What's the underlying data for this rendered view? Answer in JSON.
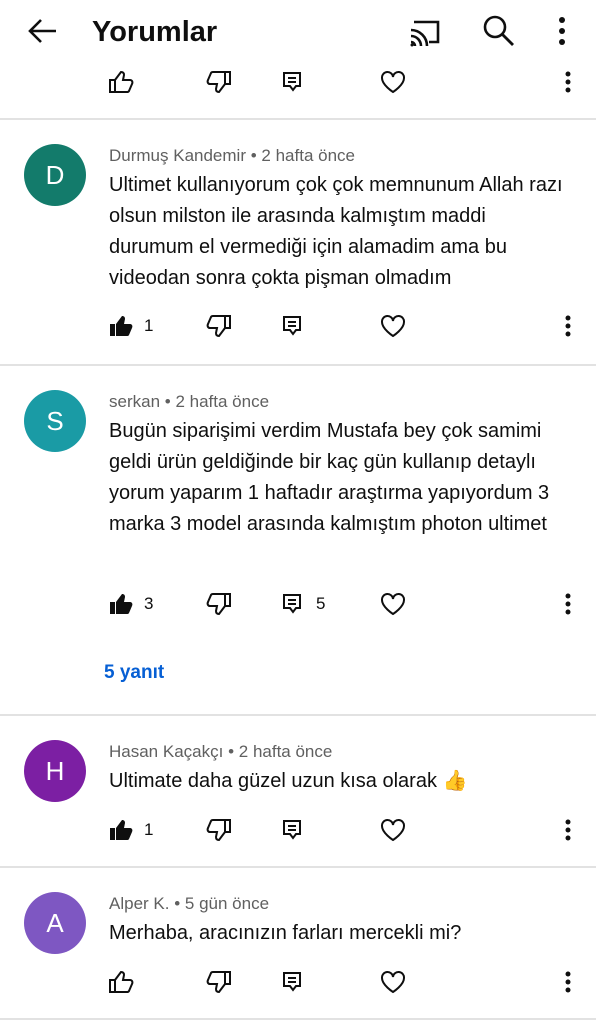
{
  "header": {
    "title": "Yorumlar"
  },
  "icons": {
    "back": "arrow-left-icon",
    "cast": "cast-icon",
    "search": "search-icon",
    "more": "more-vertical-icon",
    "like": "thumb-up-icon",
    "dislike": "thumb-down-icon",
    "reply": "reply-icon",
    "heart": "heart-icon"
  },
  "comments": [
    {
      "avatar_letter": "D",
      "avatar_color": "#137b6b",
      "author": "Durmuş Kandemir",
      "time": "2 hafta önce",
      "text": "Ultimet kullanıyorum çok çok memnunum Allah razı olsun milston ile arasında kalmıştım maddi durumum el vermediği için alamadim ama bu videodan sonra  çokta pişman olmadım",
      "likes": "1",
      "reply_count": ""
    },
    {
      "avatar_letter": "S",
      "avatar_color": "#1a9ba5",
      "author": "serkan",
      "time": "2 hafta önce",
      "text": "Bugün siparişimi verdim Mustafa bey çok samimi geldi ürün geldiğinde bir kaç gün kullanıp detaylı yorum yaparım 1 haftadır araştırma yapıyordum 3 marka 3 model arasında kalmıştım photon ultimet",
      "likes": "3",
      "reply_count": "5",
      "replies_link": "5 yanıt"
    },
    {
      "avatar_letter": "H",
      "avatar_color": "#7c1fa3",
      "author": "Hasan Kaçakçı",
      "time": "2 hafta önce",
      "text": "Ultimate daha güzel uzun kısa olarak 👍",
      "likes": "1",
      "reply_count": ""
    },
    {
      "avatar_letter": "A",
      "avatar_color": "#7e57c2",
      "author": "Alper K.",
      "time": "5 gün önce",
      "text": "Merhaba, aracınızın farları mercekli mi?",
      "likes": "",
      "reply_count": ""
    }
  ],
  "meta_separator": "•"
}
